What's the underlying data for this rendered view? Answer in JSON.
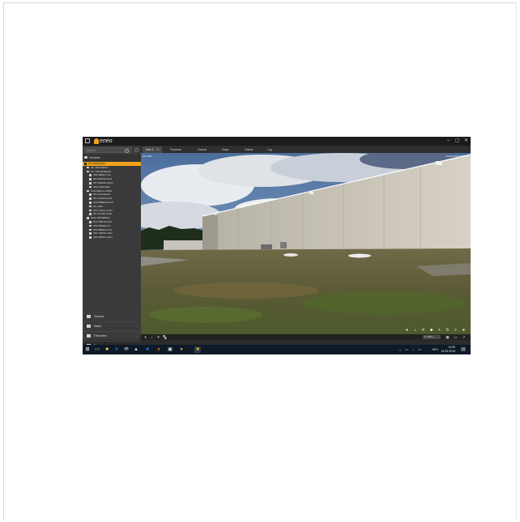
{
  "window": {
    "logo_text": "eneo",
    "minimize": "–",
    "maximize": "▢",
    "close": "✕"
  },
  "sidebar": {
    "search_placeholder": "Search",
    "devices_label": "Devices",
    "devices": [
      "IPC-D83150W0",
      "HD-180A060DU",
      "NC-T08-A84M3AN",
      "IND-980EUT-A4",
      "HD-D8A3B-1AN4",
      "IPT-T88A20-3A4N",
      "IPD-T8A3A0B4",
      "NVR-8008-A-C8DN",
      "IPT-L8A0-8A4N",
      "IPT-N6A08-1A4N",
      "HC8-08BE0AS-UP",
      "NC-1001",
      "IPD-T2A0A-1A4N",
      "IPT-T2A0B-1A4N",
      "NAR-108-8B8DI4",
      "IPC-T08L8-1A4N",
      "IND-08B0E0-T6",
      "IPD-08BE0-U-A4",
      "IND-T06D0-1A4N",
      "IND-08D00-1A4N"
    ],
    "nav": [
      {
        "label": "Groups",
        "chevron": ""
      },
      {
        "label": "Maps",
        "chevron": "›"
      },
      {
        "label": "Favorites",
        "chevron": "›"
      },
      {
        "label": "Events",
        "chevron": ""
      }
    ]
  },
  "tabs": [
    {
      "label": "Live 1",
      "close": "✕"
    },
    {
      "label": "Playback"
    },
    {
      "label": "Search"
    },
    {
      "label": "Maps"
    },
    {
      "label": "Videos"
    },
    {
      "label": "Log"
    }
  ],
  "view": {
    "camera_name": "IPC-D83",
    "timestamp": "14.09.2018 14:59:13"
  },
  "controls": {
    "layout_label": "1 / 16 ▾"
  },
  "taskbar": {
    "time": "14:59",
    "date": "14.09.2018",
    "lang": "DEU"
  }
}
